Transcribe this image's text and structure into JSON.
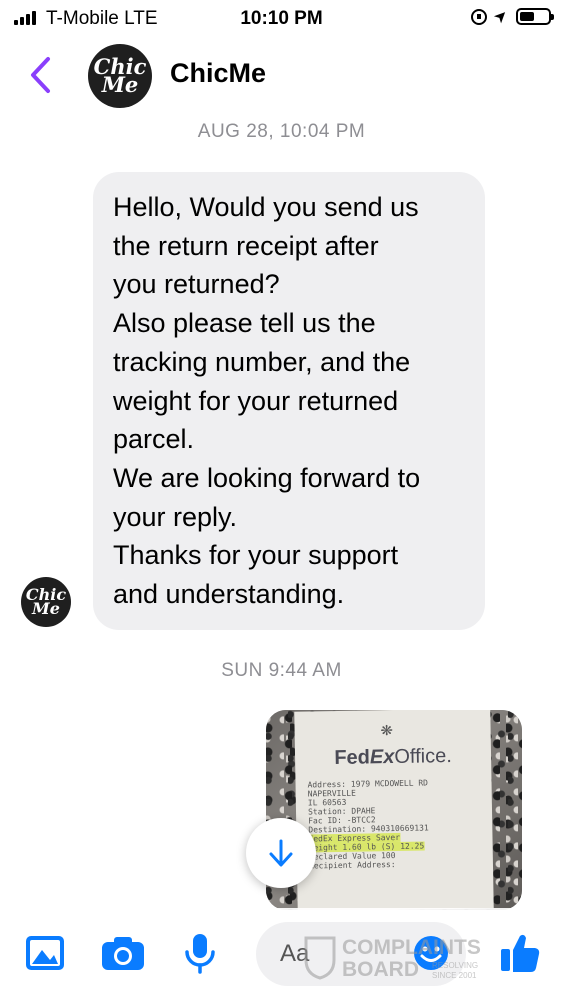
{
  "status_bar": {
    "carrier": "T-Mobile  LTE",
    "time": "10:10 PM",
    "signal_bars": 4,
    "battery_level": 0.5
  },
  "header": {
    "contact_name": "ChicMe",
    "avatar_text_line1": "Chic",
    "avatar_text_line2": "Me"
  },
  "thread": {
    "timestamp_1": "AUG 28, 10:04 PM",
    "message_1_lines": [
      "Hello, Would you send us",
      "the return receipt after",
      "you returned?",
      "Also please tell us the",
      "tracking number, and the",
      "weight for your returned",
      "parcel.",
      "We are looking forward to",
      "your reply.",
      "Thanks for your support",
      "and understanding."
    ],
    "timestamp_2": "SUN 9:44 AM",
    "attachment": {
      "logo_fed": "Fed",
      "logo_ex": "Ex",
      "logo_office": "Office.",
      "receipt_lines": [
        "Address:        1979 MCDOWELL RD",
        "                NAPERVILLE",
        "                IL 60563",
        "Station:        DPAHE",
        "Fac ID:         -BTCC2",
        "Destination:    940310669131",
        "FedEx Express Saver",
        "  Weight        1.60 lb (S)     12.25",
        "  Declared Value 100",
        "Recipient Address:"
      ]
    }
  },
  "composer": {
    "placeholder": "Aa"
  },
  "watermark": {
    "line1": "COMPLAINTS",
    "line2": "BOARD",
    "line3": "RESOLVING",
    "line4": "SINCE 2001"
  },
  "colors": {
    "accent": "#0a7cff",
    "back_chevron": "#8a3ffc",
    "bubble": "#efeff1",
    "timestamp": "#8e8e93"
  },
  "icons": {
    "gallery": "image-icon",
    "camera": "camera-icon",
    "mic": "microphone-icon",
    "emoji": "emoji-icon",
    "like": "thumbs-up-icon",
    "scroll": "arrow-down-icon"
  }
}
